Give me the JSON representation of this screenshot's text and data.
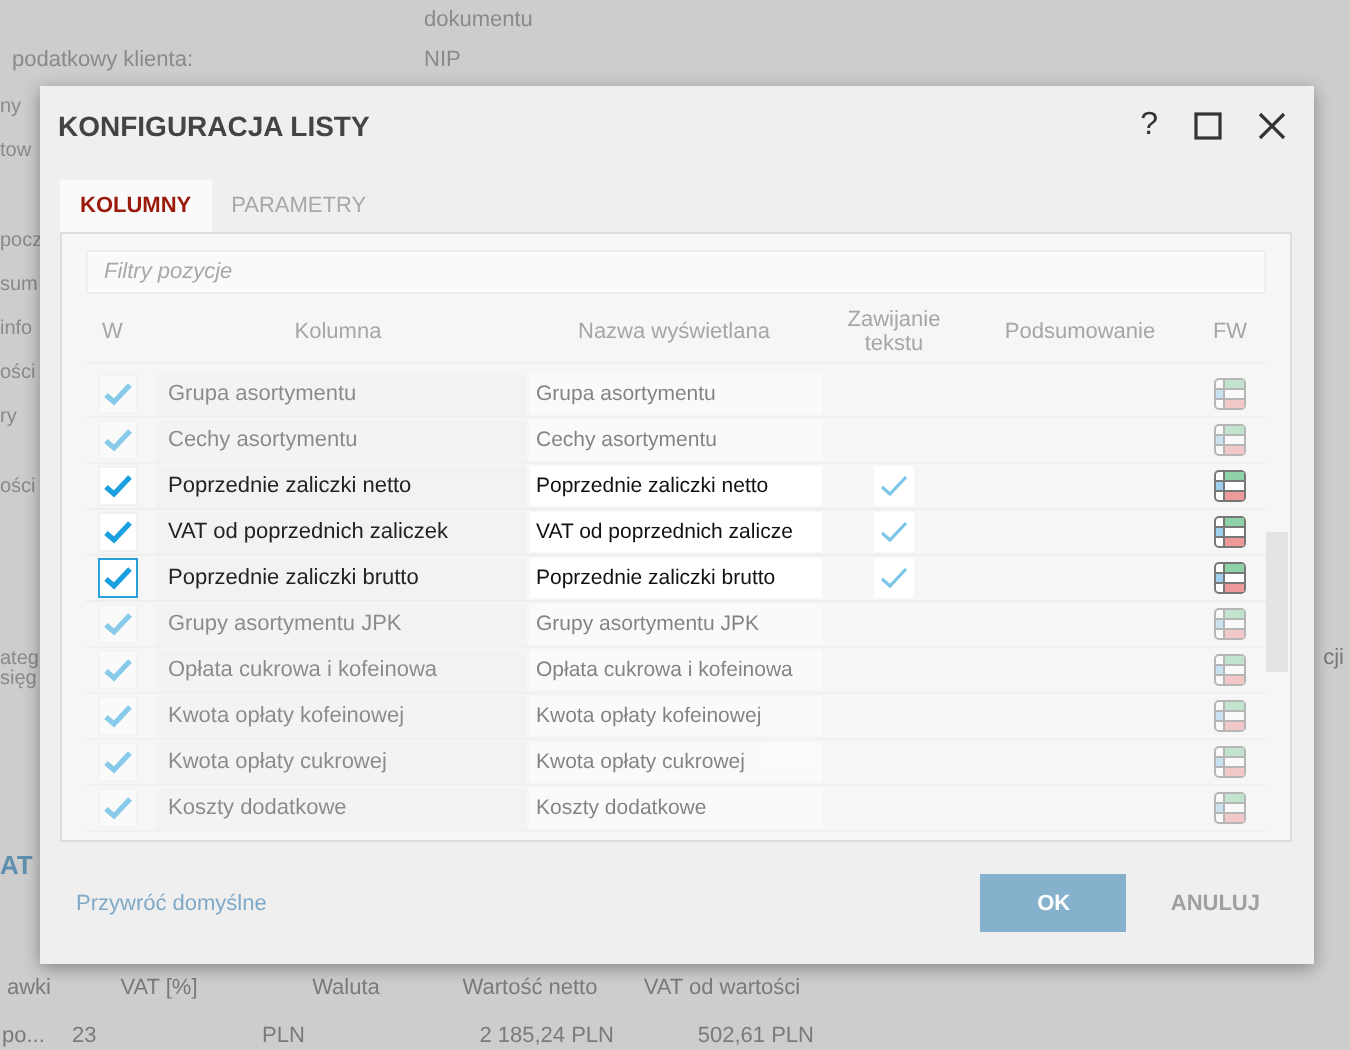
{
  "background": {
    "top_right": [
      "dokumentu",
      "NIP"
    ],
    "client_tax_label": "podatkowy klienta:",
    "left_fragments": [
      "ny",
      "tow",
      "pocz",
      "sum",
      "info",
      "ości",
      "ry",
      "ości",
      "ateg",
      "sięg"
    ],
    "right_fragment": "cji",
    "section_title": "AT",
    "table": {
      "columns": [
        "awki",
        "VAT [%]",
        "Waluta",
        "Wartość netto",
        "VAT od wartości"
      ],
      "row": [
        "po...",
        "23",
        "PLN",
        "2 185,24 PLN",
        "502,61 PLN"
      ]
    }
  },
  "dialog": {
    "title": "KONFIGURACJA LISTY",
    "help": "?",
    "tabs": [
      {
        "label": "KOLUMNY",
        "selected": true
      },
      {
        "label": "PARAMETRY",
        "selected": false
      }
    ],
    "filter": {
      "placeholder": "Filtry pozycje"
    },
    "columns": [
      "W",
      "Kolumna",
      "Nazwa wyświetlana",
      "Zawijanie tekstu",
      "Podsumowanie",
      "FW"
    ],
    "rows": [
      {
        "checked": true,
        "name": "Grupa asortymentu",
        "display_name": "Grupa asortymentu",
        "wrap": false,
        "highlighted": false,
        "focused": false
      },
      {
        "checked": true,
        "name": "Cechy asortymentu",
        "display_name": "Cechy asortymentu",
        "wrap": false,
        "highlighted": false,
        "focused": false
      },
      {
        "checked": true,
        "name": "Poprzednie zaliczki netto",
        "display_name": "Poprzednie zaliczki netto",
        "wrap": true,
        "highlighted": true,
        "focused": false
      },
      {
        "checked": true,
        "name": "VAT od poprzednich zaliczek",
        "display_name": "VAT od poprzednich zalicze",
        "wrap": true,
        "highlighted": true,
        "focused": false
      },
      {
        "checked": true,
        "name": "Poprzednie zaliczki brutto",
        "display_name": "Poprzednie zaliczki brutto",
        "wrap": true,
        "highlighted": true,
        "focused": true
      },
      {
        "checked": true,
        "name": "Grupy asortymentu JPK",
        "display_name": "Grupy asortymentu JPK",
        "wrap": false,
        "highlighted": false,
        "focused": false
      },
      {
        "checked": true,
        "name": "Opłata cukrowa i kofeinowa",
        "display_name": "Opłata cukrowa i kofeinowa",
        "wrap": false,
        "highlighted": false,
        "focused": false
      },
      {
        "checked": true,
        "name": "Kwota opłaty kofeinowej",
        "display_name": "Kwota opłaty kofeinowej",
        "wrap": false,
        "highlighted": false,
        "focused": false
      },
      {
        "checked": true,
        "name": "Kwota opłaty cukrowej",
        "display_name": "Kwota opłaty cukrowej",
        "wrap": false,
        "highlighted": false,
        "focused": false
      },
      {
        "checked": true,
        "name": "Koszty dodatkowe",
        "display_name": "Koszty dodatkowe",
        "wrap": false,
        "highlighted": false,
        "focused": false
      }
    ],
    "restore_link": "Przywróć domyślne",
    "ok_button": "OK",
    "cancel_button": "ANULUJ"
  }
}
